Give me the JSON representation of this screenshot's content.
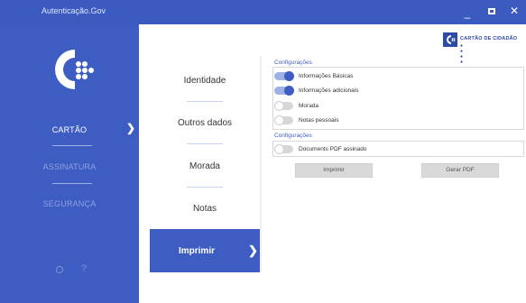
{
  "window": {
    "title": "Autenticação.Gov",
    "minimize_label": "_",
    "close_label": "✕"
  },
  "sidebar": {
    "items": [
      {
        "label": "CARTÃO",
        "active": true
      },
      {
        "label": "ASSINATURA",
        "active": false
      },
      {
        "label": "SEGURANÇA",
        "active": false
      }
    ],
    "help_label": "?",
    "accent_color": "#3e5dc3"
  },
  "menu": {
    "items": [
      "Identidade",
      "Outros dados",
      "Morada",
      "Notas"
    ],
    "active_label": "Imprimir"
  },
  "brand": {
    "text": "CARTÃO DE CIDADÃO",
    "dots": "● ● ● ●"
  },
  "print_options": {
    "section1_title": "Configurações",
    "options": [
      {
        "label": "Informações Básicas",
        "enabled": true
      },
      {
        "label": "Informações adicionais",
        "enabled": true
      },
      {
        "label": "Morada",
        "enabled": false
      },
      {
        "label": "Notas pessoais",
        "enabled": false
      }
    ],
    "section2_title": "Configurações",
    "signed_pdf": {
      "label": "Documents PDF assinado",
      "enabled": false
    },
    "print_button": "Imprimir",
    "pdf_button": "Gerar PDF"
  }
}
